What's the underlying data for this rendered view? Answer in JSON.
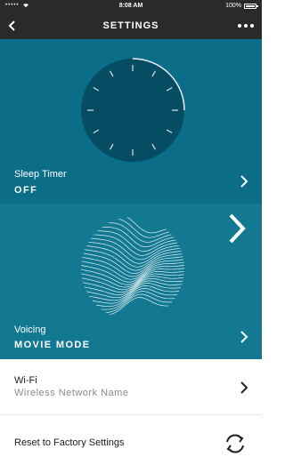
{
  "status_bar": {
    "carrier_dots": "•••••",
    "time": "8:08 AM",
    "battery": "100%"
  },
  "nav": {
    "title": "SETTINGS"
  },
  "sleep_timer": {
    "label": "Sleep Timer",
    "value": "OFF"
  },
  "voicing": {
    "label": "Voicing",
    "value": "MOVIE MODE"
  },
  "wifi": {
    "label": "Wi-Fi",
    "value": "Wireless Network Name"
  },
  "reset": {
    "label": "Reset to Factory Settings"
  },
  "colors": {
    "bar": "#2a2a2a",
    "panel_top": "#0b6d87",
    "panel_bottom": "#137892",
    "dial": "#064c62"
  }
}
